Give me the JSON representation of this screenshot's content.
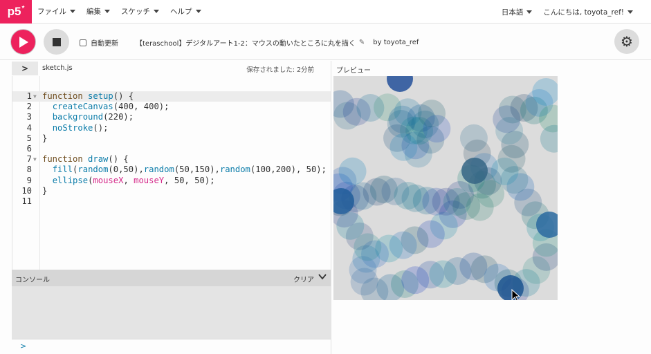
{
  "nav": {
    "logo": "p5",
    "logo_star": "*",
    "menus": [
      "ファイル",
      "編集",
      "スケッチ",
      "ヘルプ"
    ],
    "language": "日本語",
    "greeting": "こんにちは, toyota_ref!"
  },
  "toolbar": {
    "auto_refresh_label": "自動更新",
    "auto_refresh_checked": false,
    "project_name": "【teraschool】デジタルアート1-2：マウスの動いたところに丸を描く",
    "owner": "by toyota_ref"
  },
  "editor": {
    "sidebar_toggle": ">",
    "filename": "sketch.js",
    "saved_status": "保存されました: 2分前",
    "line_numbers": [
      "1",
      "2",
      "3",
      "4",
      "5",
      "6",
      "7",
      "8",
      "9",
      "10",
      "11"
    ]
  },
  "preview": {
    "label": "プレビュー"
  },
  "console": {
    "title": "コンソール",
    "clear_label": "クリア",
    "prompt": ">"
  },
  "colors": {
    "brand": "#ed225d",
    "keyword": "#704f21",
    "function": "#0b7ca9",
    "variable": "#d52889",
    "canvas_bg": "#dcdcdc"
  }
}
